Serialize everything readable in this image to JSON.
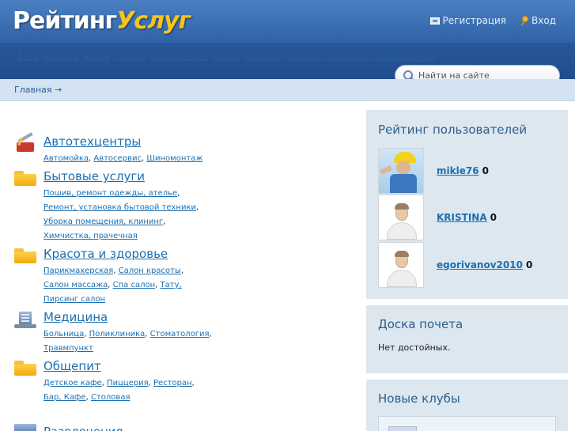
{
  "header": {
    "logo_part1": "Рейтинг",
    "logo_part2": "Услуг",
    "register_label": "Регистрация",
    "login_label": "Вход"
  },
  "nav": {
    "items": [
      "База",
      "Новости",
      "Блоги",
      "Статьи",
      "Фотогалерея",
      "Клубы",
      "Форумы",
      "Каталог объектов",
      "Пользователи"
    ]
  },
  "search": {
    "placeholder": "Найти на сайте"
  },
  "breadcrumb": {
    "home": "Главная →"
  },
  "categories": [
    {
      "title": "Автотехцентры",
      "subs": [
        "Автомойка",
        "Автосервис",
        "Шиномонтаж"
      ]
    },
    {
      "title": "Бытовые услуги",
      "subs": [
        "Пошив, ремонт одежды, ателье",
        "Ремонт, установка бытовой техники",
        "Уборка помещения, клининг",
        "Химчистка, прачечная"
      ]
    },
    {
      "title": "Красота и здоровье",
      "subs": [
        "Парикмахерская",
        "Салон красоты",
        "Салон массажа",
        "Спа салон",
        "Тату,",
        "Пирсинг салон"
      ]
    },
    {
      "title": "Медицина",
      "subs": [
        "Больница",
        "Поликлиника",
        "Стоматология",
        "Травмпункт"
      ]
    },
    {
      "title": "Общепит",
      "subs": [
        "Детское кафе",
        "Пиццерия",
        "Ресторан",
        "Бар, Кафе",
        "Столовая"
      ]
    },
    {
      "title": "Развлечения"
    }
  ],
  "users_panel": {
    "title": "Рейтинг пользователей",
    "users": [
      {
        "name": "mikle76",
        "score": "0"
      },
      {
        "name": "KRISTINA",
        "score": "0"
      },
      {
        "name": "egorivanov2010",
        "score": "0"
      }
    ]
  },
  "honor_panel": {
    "title": "Доска почета",
    "text": "Нет достойных."
  },
  "clubs_panel": {
    "title": "Новые клубы"
  }
}
